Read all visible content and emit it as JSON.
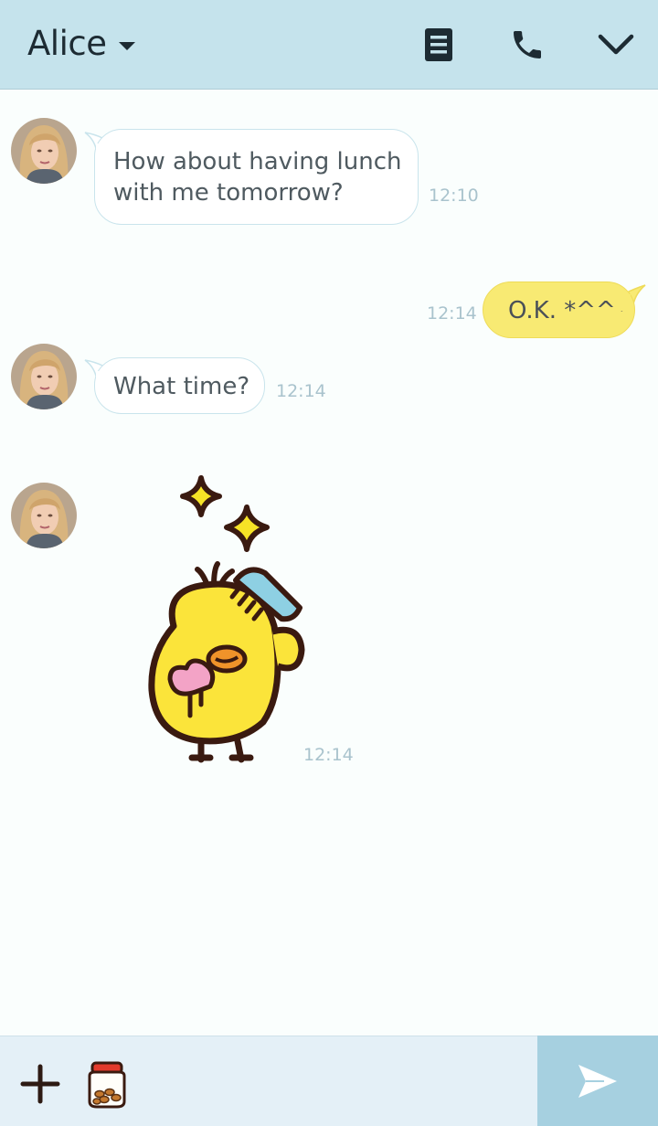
{
  "header": {
    "contact_name": "Alice",
    "icons": [
      "caret-down",
      "notes",
      "phone",
      "chevron-down"
    ],
    "background": "#c5e3ec"
  },
  "messages": [
    {
      "sender": "Alice",
      "direction": "incoming",
      "type": "text",
      "lines": [
        "How about having lunch",
        "with me tomorrow?"
      ],
      "time": "12:10"
    },
    {
      "sender": "me",
      "direction": "outgoing",
      "type": "text",
      "text": "O.K. *^^*",
      "time": "12:14"
    },
    {
      "sender": "Alice",
      "direction": "incoming",
      "type": "text",
      "text": "What time?",
      "time": "12:14"
    },
    {
      "sender": "Alice",
      "direction": "incoming",
      "type": "sticker",
      "sticker": "yellow-chick-combing",
      "time": "12:14"
    }
  ],
  "composer": {
    "icons": [
      "plus",
      "sticker-jar",
      "send"
    ]
  },
  "colors": {
    "incoming_bubble": "#ffffff",
    "outgoing_bubble": "#f8ea73",
    "timestamp": "#a9c3cd",
    "send_button": "#a6d0e0"
  }
}
